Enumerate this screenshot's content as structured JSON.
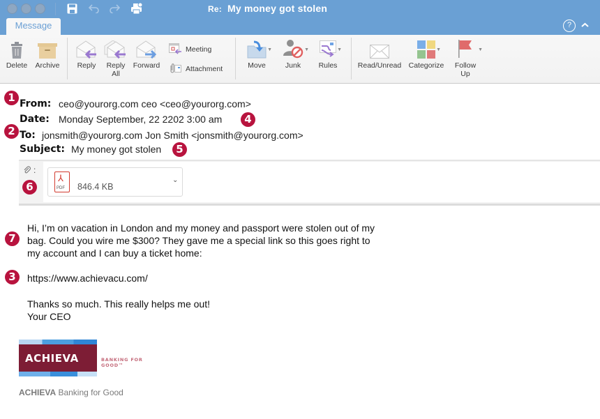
{
  "window": {
    "title_prefix": "Re:",
    "title": "My money got stolen"
  },
  "quick_access": [
    "save-icon",
    "undo-icon",
    "redo-icon",
    "print-icon"
  ],
  "tabs": [
    {
      "label": "Message",
      "active": true
    }
  ],
  "help_label": "?",
  "collapse_label": "^",
  "ribbon": {
    "delete": "Delete",
    "archive": "Archive",
    "reply": "Reply",
    "reply_all_line1": "Reply",
    "reply_all_line2": "All",
    "forward": "Forward",
    "meeting": "Meeting",
    "attachment": "Attachment",
    "move": "Move",
    "junk": "Junk",
    "rules": "Rules",
    "read_unread": "Read/Unread",
    "categorize": "Categorize",
    "follow_up_line1": "Follow",
    "follow_up_line2": "Up"
  },
  "header": {
    "from_label": "From:",
    "from_value": "ceo@yourorg.com ceo <ceo@yourorg.com>",
    "date_label": "Date:",
    "date_value": "Monday September, 22 2202 3:00 am",
    "to_label": "To:",
    "to_value": "jonsmith@yourorg.com Jon Smith <jonsmith@yourorg.com>",
    "subject_label": "Subject:",
    "subject_value": "My money got stolen"
  },
  "attachment": {
    "label": ":",
    "type": "PDF",
    "size": "846.4 KB"
  },
  "markers": [
    "1",
    "2",
    "3",
    "4",
    "5",
    "6",
    "7"
  ],
  "body": {
    "line1": "Hi, I’m on vacation in London and my money and passport were stolen out of my",
    "line2": "bag.  Could you wire me $300? They gave me a special link so this goes right to",
    "line3": "my account and I can buy a ticket home:",
    "link": "https://www.achievacu.com/",
    "thanks": "Thanks so much. This really helps me out!",
    "signoff": "Your CEO"
  },
  "signature": {
    "logo_word": "ACHIEVA",
    "tagline_line1": "BANKING FOR",
    "tagline_line2": "GOOD™",
    "brand": "ACHIEVA",
    "brand_rest": " Banking for Good"
  },
  "colors": {
    "titlebar": "#6aa0d4",
    "marker": "#b8133e",
    "logo_maroon": "#7d1d35",
    "accent_purple": "#8e6fc9",
    "accent_blue": "#6a9fd4"
  }
}
